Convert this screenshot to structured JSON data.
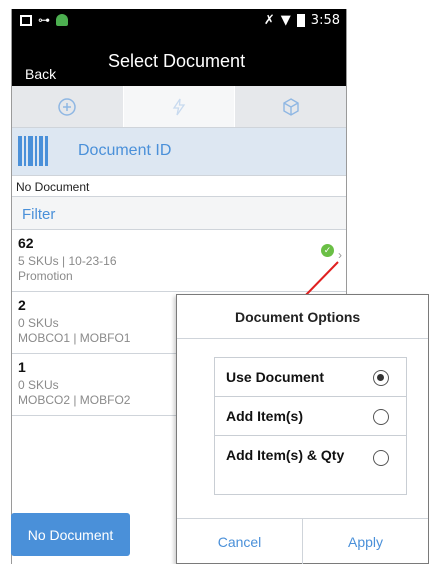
{
  "status_bar": {
    "time": "3:58"
  },
  "header": {
    "back_label": "Back",
    "title": "Select Document"
  },
  "tabs": [
    {
      "icon": "plus-circle-icon",
      "active": false
    },
    {
      "icon": "lightning-icon",
      "active": true
    },
    {
      "icon": "cube-icon",
      "active": false
    }
  ],
  "document_id": {
    "label": "Document ID",
    "icon": "barcode-icon"
  },
  "current_document": "No Document",
  "filter_label": "Filter",
  "documents": [
    {
      "id": "62",
      "line1": "5 SKUs  |  10-23-16",
      "line2": "Promotion",
      "selected": true
    },
    {
      "id": "2",
      "line1": "0 SKUs",
      "line2": "MOBCO1  |  MOBFO1",
      "selected": false
    },
    {
      "id": "1",
      "line1": "0 SKUs",
      "line2": "MOBCO2  |  MOBFO2",
      "selected": false
    }
  ],
  "bottom_button_label": "No Document",
  "dialog": {
    "title": "Document Options",
    "options": [
      {
        "label": "Use Document",
        "selected": true
      },
      {
        "label": "Add Item(s)",
        "selected": false
      },
      {
        "label": "Add Item(s) & Qty",
        "selected": false
      }
    ],
    "cancel_label": "Cancel",
    "apply_label": "Apply"
  },
  "colors": {
    "accent": "#4a90d9",
    "check": "#6abf45",
    "pointer_line": "#e02020"
  }
}
